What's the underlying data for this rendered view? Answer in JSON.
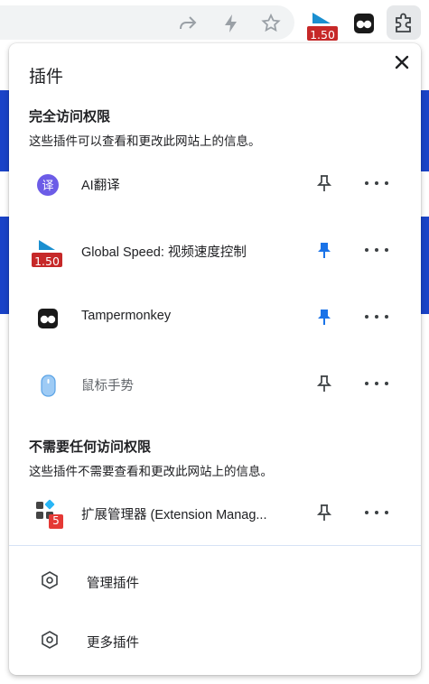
{
  "toolbar": {
    "speed_badge": "1.50"
  },
  "popup": {
    "title": "插件",
    "full_access": {
      "heading": "完全访问权限",
      "description": "这些插件可以查看和更改此网站上的信息。",
      "items": [
        {
          "name": "AI翻译",
          "icon": "translate-icon",
          "pinned": false
        },
        {
          "name": "Global Speed: 视频速度控制",
          "icon": "global-speed-icon",
          "badge": "1.50",
          "pinned": true
        },
        {
          "name": "Tampermonkey",
          "icon": "tampermonkey-icon",
          "pinned": true
        },
        {
          "name": "鼠标手势",
          "icon": "mouse-gesture-icon",
          "pinned": false
        }
      ]
    },
    "no_access": {
      "heading": "不需要任何访问权限",
      "description": "这些插件不需要查看和更改此网站上的信息。",
      "items": [
        {
          "name": "扩展管理器 (Extension Manag...",
          "icon": "extension-manager-icon",
          "badge": "5",
          "pinned": false
        }
      ]
    },
    "footer": {
      "manage": "管理插件",
      "more": "更多插件"
    }
  },
  "colors": {
    "pin_active": "#1a73e8",
    "pin_inactive": "#3c4043",
    "speed_badge_bg": "#c62828",
    "ext_badge_bg": "#e53935"
  }
}
